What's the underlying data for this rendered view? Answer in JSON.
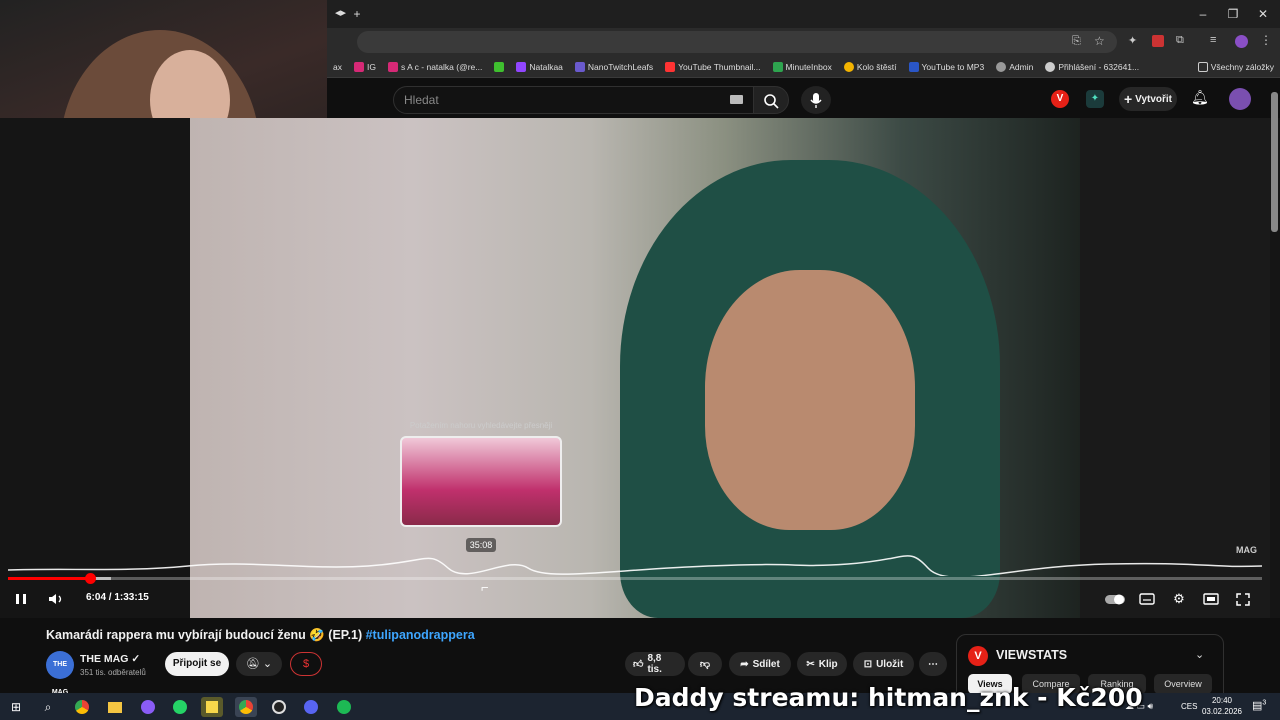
{
  "browser": {
    "bookmarks": [
      {
        "label": "ax",
        "color": "#888888"
      },
      {
        "label": "IG",
        "color": "#d62976"
      },
      {
        "label": "s A c - natalka (@re...",
        "color": "#d62976"
      },
      {
        "label": "",
        "color": "#3fbf2f"
      },
      {
        "label": "Natalkaa",
        "color": "#9146ff"
      },
      {
        "label": "NanoTwitchLeafs",
        "color": "#6a5acd"
      },
      {
        "label": "YouTube Thumbnail...",
        "color": "#ff3333"
      },
      {
        "label": "MinuteInbox",
        "color": "#2ea44f"
      },
      {
        "label": "Kolo štěstí",
        "color": "#f4b400"
      },
      {
        "label": "YouTube to MP3",
        "color": "#2a56c6"
      },
      {
        "label": "Admin",
        "color": "#999999"
      },
      {
        "label": "Přihlášení - 632641...",
        "color": "#cccccc"
      }
    ],
    "all_bookmarks": "Všechny záložky"
  },
  "youtube": {
    "search_placeholder": "Hledat",
    "create_label": "Vytvořit",
    "player": {
      "preview_hint": "Potažením nahoru vyhledávejte přesněji",
      "hover_time": "35:08",
      "time_display": "6:04 / 1:33:15",
      "progress_played": 0.065,
      "progress_buffered": 0.082,
      "hover_position": 0.38,
      "watermark": "MAG"
    },
    "video": {
      "title": "Kamarádi rappera mu vybírají budoucí ženu 🤣 (EP.1)",
      "hashtag": "#tulipanodrappera"
    },
    "channel": {
      "avatar_text": "THE MAG",
      "name": "THE MAG ✓",
      "subscribers": "351 tis. odběratelů",
      "subscribe_label": "Připojit se",
      "join_symbol": "$"
    },
    "actions": {
      "likes": "8,8 tis.",
      "share": "Sdílet",
      "clip": "Klip",
      "save": "Uložit",
      "more": "⋯"
    }
  },
  "viewstats": {
    "logo": "V",
    "title": "VIEWSTATS",
    "tabs": [
      "Views",
      "Compare",
      "Ranking",
      "Overview"
    ],
    "active_tab": "Views"
  },
  "overlay": {
    "donation_text": "Daddy streamu: hitman_znk - Kč200"
  },
  "taskbar": {
    "language": "CES",
    "time": "20:40",
    "date": "03.02.2026",
    "notifications": "3"
  }
}
